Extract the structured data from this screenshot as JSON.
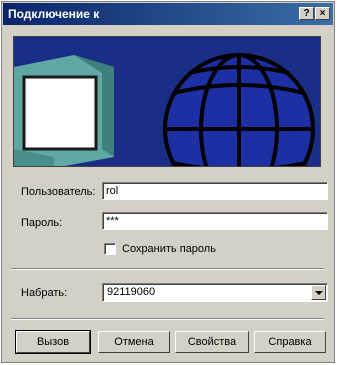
{
  "window": {
    "title": "Подключение к"
  },
  "titlebar": {
    "help": "?",
    "close": "×"
  },
  "form": {
    "user_label": "Пользователь:",
    "user_value": "rol",
    "password_label": "Пароль:",
    "password_value": "***",
    "save_password_label": "Сохранить пароль",
    "save_password_checked": false,
    "dial_label": "Набрать:",
    "dial_value": "92119060"
  },
  "buttons": {
    "call": "Вызов",
    "cancel": "Отмена",
    "properties": "Свойства",
    "help": "Справка"
  },
  "colors": {
    "titlebar": "#0a246a",
    "banner_bg": "#1a2e85",
    "monitor": "#5fa8a3",
    "globe": "#1c2fa3"
  }
}
